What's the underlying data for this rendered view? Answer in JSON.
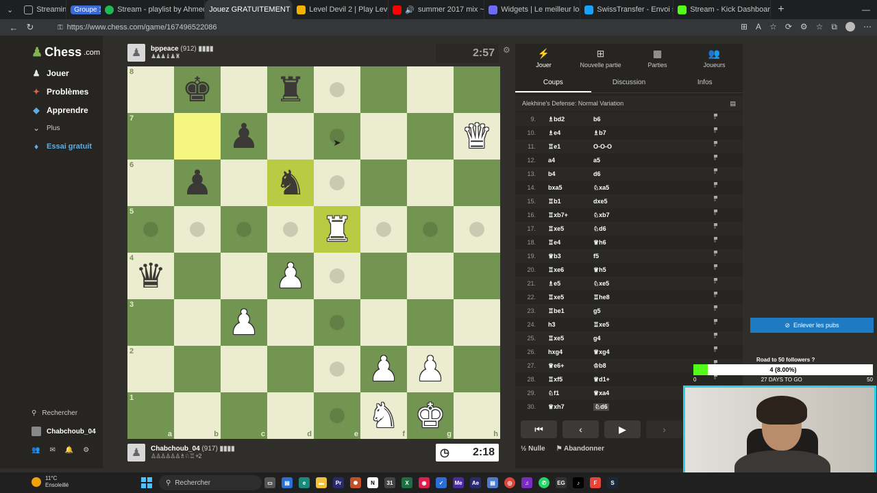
{
  "browser": {
    "tabs": [
      {
        "label": "Streaming",
        "color": "#5f6368",
        "group": "Groupe 1"
      },
      {
        "label": "Stream - playlist by Ahmed |",
        "color": "#1db954"
      },
      {
        "label": "Jouez GRATUITEMENT aux éc",
        "color": "#81b64c",
        "active": true
      },
      {
        "label": "Level Devil 2 | Play Level Devil",
        "color": "#f0b400"
      },
      {
        "label": "summer 2017 mix ~nost",
        "color": "#ff0000"
      },
      {
        "label": "Widgets | Le meilleur logiciel",
        "color": "#6b6bff"
      },
      {
        "label": "SwissTransfer - Envoi sécurisé",
        "color": "#14a3ff"
      },
      {
        "label": "Stream - Kick Dashboard",
        "color": "#53fc18"
      }
    ],
    "url": "https://www.chess.com/game/167496522086"
  },
  "nav": {
    "logo_text": "Chess",
    "logo_suffix": ".com",
    "items": [
      {
        "label": "Jouer",
        "icon": "pawn-icon",
        "color": "#e5e5e5"
      },
      {
        "label": "Problèmes",
        "icon": "puzzle-icon",
        "color": "#e2633f"
      },
      {
        "label": "Apprendre",
        "icon": "learn-icon",
        "color": "#5dade2"
      },
      {
        "label": "Plus",
        "icon": "chevron-down-icon",
        "color": "#ccc"
      }
    ],
    "trial": "Essai gratuit",
    "search": "Rechercher",
    "user": "Chabchoub_04"
  },
  "players": {
    "top": {
      "name": "bppeace",
      "rating": "(912)",
      "clock": "2:57",
      "captured": "♟♟♟♝♟♜"
    },
    "bottom": {
      "name": "Chabchoub_04",
      "rating": "(917)",
      "clock": "2:18",
      "captured": "♙♙♙♙♙♙♗♘♖ +2"
    }
  },
  "board": {
    "files": [
      "a",
      "b",
      "c",
      "d",
      "e",
      "f",
      "g",
      "h"
    ],
    "ranks": [
      "8",
      "7",
      "6",
      "5",
      "4",
      "3",
      "2",
      "1"
    ],
    "pieces": {
      "b8": "bk",
      "d8": "br",
      "h7": "wq",
      "c7": "bp",
      "b6": "bp",
      "d6": "bn",
      "e5": "wr",
      "a4": "bq",
      "d4": "wp",
      "c3": "wp",
      "f2": "wp",
      "g2": "wp",
      "f1": "wn",
      "g1": "wk"
    },
    "highlight": [
      "b7",
      "d6",
      "e5"
    ],
    "dots": [
      "e8",
      "e7",
      "e6",
      "a5",
      "b5",
      "c5",
      "d5",
      "f5",
      "g5",
      "h5",
      "e4",
      "e3",
      "e2",
      "e1"
    ]
  },
  "panel": {
    "topnav": [
      {
        "label": "Jouer",
        "icon": "lightning-icon"
      },
      {
        "label": "Nouvelle partie",
        "icon": "plus-icon"
      },
      {
        "label": "Parties",
        "icon": "board-icon"
      },
      {
        "label": "Joueurs",
        "icon": "people-icon"
      }
    ],
    "subtabs": [
      "Coups",
      "Discussion",
      "Infos"
    ],
    "opening": "Alekhine's Defense: Normal Variation",
    "moves": [
      {
        "n": "9.",
        "w": "♗bd2",
        "b": "b6"
      },
      {
        "n": "10.",
        "w": "♗e4",
        "b": "♗b7"
      },
      {
        "n": "11.",
        "w": "♖e1",
        "b": "O-O-O"
      },
      {
        "n": "12.",
        "w": "a4",
        "b": "a5"
      },
      {
        "n": "13.",
        "w": "b4",
        "b": "d6"
      },
      {
        "n": "14.",
        "w": "bxa5",
        "b": "♘xa5"
      },
      {
        "n": "15.",
        "w": "♖b1",
        "b": "dxe5"
      },
      {
        "n": "16.",
        "w": "♖xb7+",
        "b": "♘xb7"
      },
      {
        "n": "17.",
        "w": "♖xe5",
        "b": "♘d6"
      },
      {
        "n": "18.",
        "w": "♖e4",
        "b": "♕h6"
      },
      {
        "n": "19.",
        "w": "♕b3",
        "b": "f5"
      },
      {
        "n": "20.",
        "w": "♖xe6",
        "b": "♕h5"
      },
      {
        "n": "21.",
        "w": "♗e5",
        "b": "♘xe5"
      },
      {
        "n": "22.",
        "w": "♖xe5",
        "b": "♖he8"
      },
      {
        "n": "23.",
        "w": "♖be1",
        "b": "g5"
      },
      {
        "n": "24.",
        "w": "h3",
        "b": "♖xe5"
      },
      {
        "n": "25.",
        "w": "♖xe5",
        "b": "g4"
      },
      {
        "n": "26.",
        "w": "hxg4",
        "b": "♕xg4"
      },
      {
        "n": "27.",
        "w": "♕e6+",
        "b": "♔b8"
      },
      {
        "n": "28.",
        "w": "♖xf5",
        "b": "♕d1+"
      },
      {
        "n": "29.",
        "w": "♘f1",
        "b": "♕xa4"
      },
      {
        "n": "30.",
        "w": "♕xh7",
        "b": "♘d6"
      }
    ],
    "draw": "Nulle",
    "resign": "Abandonner"
  },
  "overlay": {
    "ad_button": "Enlever les pubs",
    "goal_title": "Road to 50 followers ?",
    "goal_value": "4 (8.00%)",
    "goal_progress": 0.08,
    "goal_min": "0",
    "goal_days": "27 DAYS TO GO",
    "goal_max": "50"
  },
  "taskbar": {
    "temp": "11°C",
    "weather": "Ensoleillé",
    "search": "Rechercher"
  }
}
